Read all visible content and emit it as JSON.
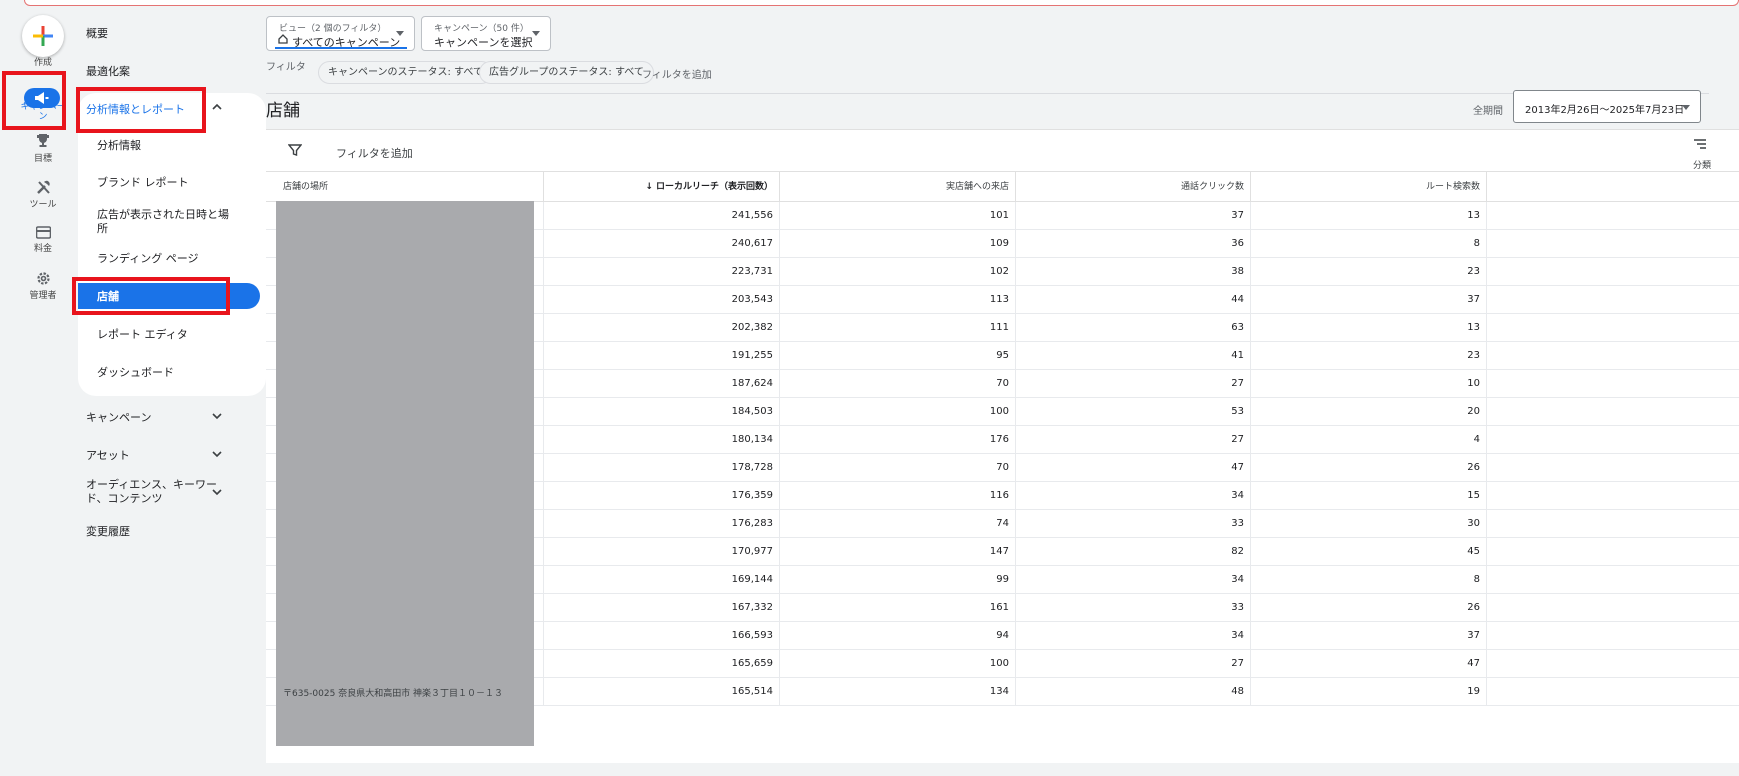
{
  "rail": {
    "create_label": "作成",
    "campaign_label": "キャンペーン",
    "goals_label": "目標",
    "tools_label": "ツール",
    "billing_label": "料金",
    "admin_label": "管理者"
  },
  "nav": {
    "overview": "概要",
    "recommendations": "最適化案",
    "insights_reports": "分析情報とレポート",
    "sub": {
      "insights": "分析情報",
      "brand_report": "ブランド レポート",
      "when_where_line1": "広告が表示された日時と場",
      "when_where_line2": "所",
      "landing_pages": "ランディング ページ",
      "stores": "店舗",
      "report_editor": "レポート エディタ",
      "dashboards": "ダッシュボード"
    },
    "campaigns": "キャンペーン",
    "assets": "アセット",
    "audiences_line1": "オーディエンス、キーワー",
    "audiences_line2": "ド、コンテンツ",
    "change_history": "変更履歴"
  },
  "view_dropdown": {
    "small": "ビュー（2 個のフィルタ）",
    "value": "すべてのキャンペーン"
  },
  "campaign_dropdown": {
    "small": "キャンペーン（50 件）",
    "value": "キャンペーンを選択"
  },
  "filters": {
    "label": "フィルタ",
    "chip1": "キャンペーンのステータス: すべて",
    "chip2": "広告グループのステータス: すべて",
    "add": "フィルタを追加"
  },
  "page_title": "店舗",
  "date": {
    "period_label": "全期間",
    "range": "2013年2月26日～2025年7月23日"
  },
  "table": {
    "add_filter": "フィルタを追加",
    "segment_label": "分類",
    "headers": {
      "location": "店舗の場所",
      "reach": "↓ ローカルリーチ（表示回数）",
      "visits": "実店舗への来店",
      "calls": "通話クリック数",
      "directions": "ルート検索数"
    },
    "rows": [
      [
        "241,556",
        "101",
        "37",
        "13"
      ],
      [
        "240,617",
        "109",
        "36",
        "8"
      ],
      [
        "223,731",
        "102",
        "38",
        "23"
      ],
      [
        "203,543",
        "113",
        "44",
        "37"
      ],
      [
        "202,382",
        "111",
        "63",
        "13"
      ],
      [
        "191,255",
        "95",
        "41",
        "23"
      ],
      [
        "187,624",
        "70",
        "27",
        "10"
      ],
      [
        "184,503",
        "100",
        "53",
        "20"
      ],
      [
        "180,134",
        "176",
        "27",
        "4"
      ],
      [
        "178,728",
        "70",
        "47",
        "26"
      ],
      [
        "176,359",
        "116",
        "34",
        "15"
      ],
      [
        "176,283",
        "74",
        "33",
        "30"
      ],
      [
        "170,977",
        "147",
        "82",
        "45"
      ],
      [
        "169,144",
        "99",
        "34",
        "8"
      ],
      [
        "167,332",
        "161",
        "33",
        "26"
      ],
      [
        "166,593",
        "94",
        "34",
        "37"
      ],
      [
        "165,659",
        "100",
        "27",
        "47"
      ],
      [
        "165,514",
        "134",
        "48",
        "19"
      ]
    ],
    "last_address": "〒635-0025 奈良県大和高田市 神楽３丁目１０－１３"
  },
  "colors": {
    "accent": "#1a73e8",
    "highlight": "#e8141c"
  }
}
